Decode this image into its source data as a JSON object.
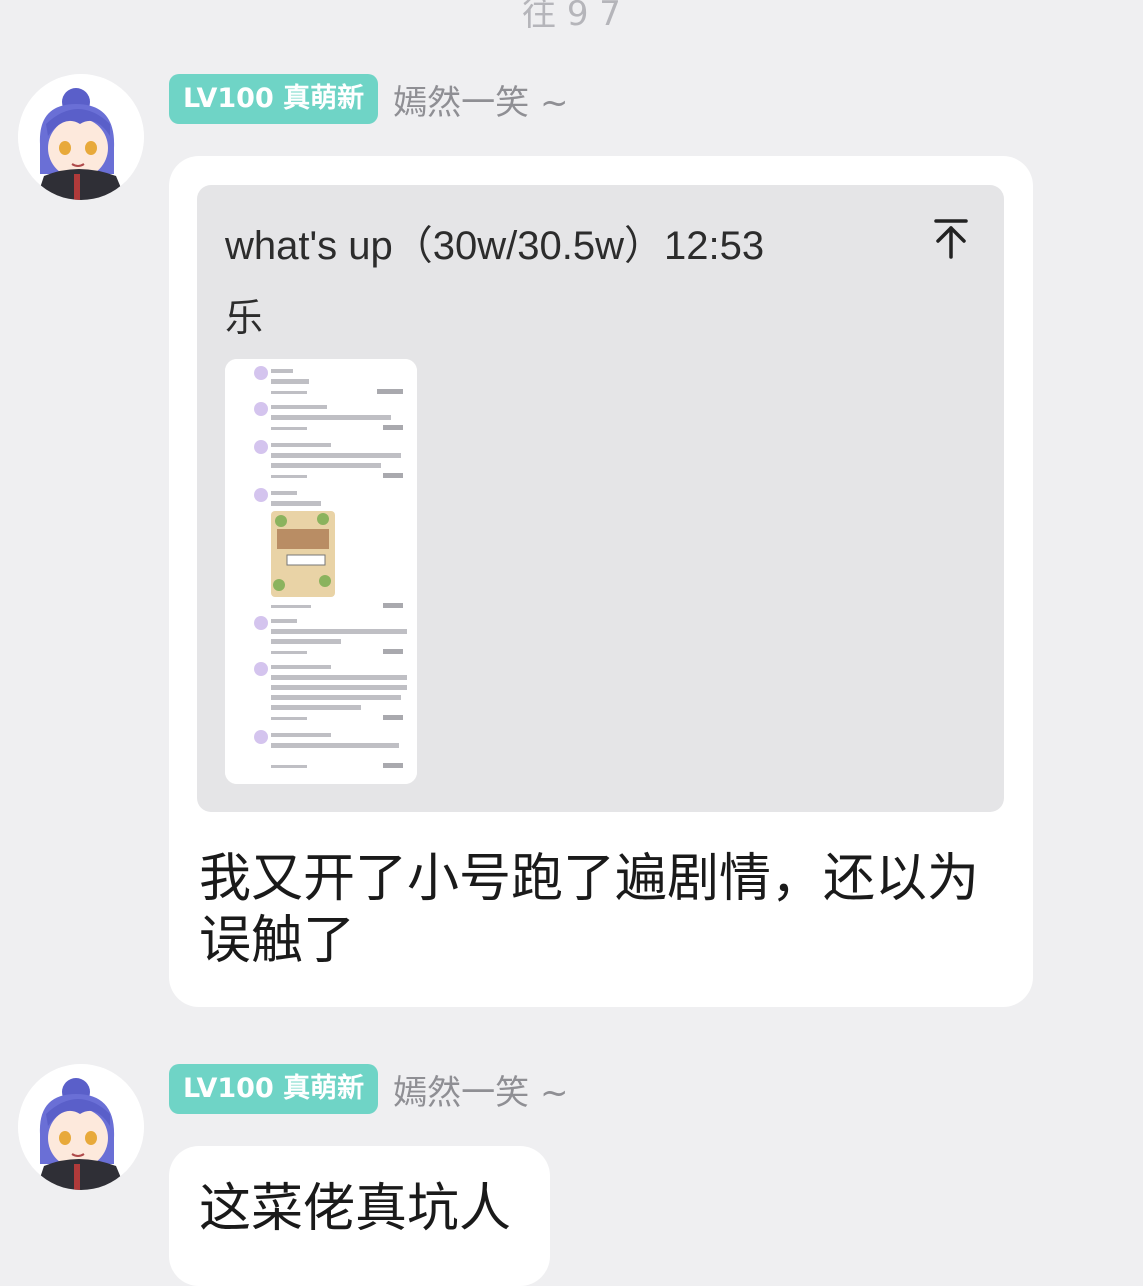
{
  "top_partial_text": "往 9 7",
  "messages": [
    {
      "level_badge": "LV100 真萌新",
      "nickname": "嫣然一笑 ~",
      "quote": {
        "header": "what's up（30w/30.5w）12:53",
        "text": "乐",
        "up_icon": "arrow-up-to-top-icon"
      },
      "text": "我又开了小号跑了遍剧情，还以为误触了"
    },
    {
      "level_badge": "LV100 真萌新",
      "nickname": "嫣然一笑 ~",
      "text": "这菜佬真坑人"
    }
  ],
  "colors": {
    "background": "#efeff1",
    "badge": "#6fd4c6",
    "bubble": "#ffffff",
    "quote_bg": "#e5e5e7",
    "nickname": "#8f8f94"
  }
}
